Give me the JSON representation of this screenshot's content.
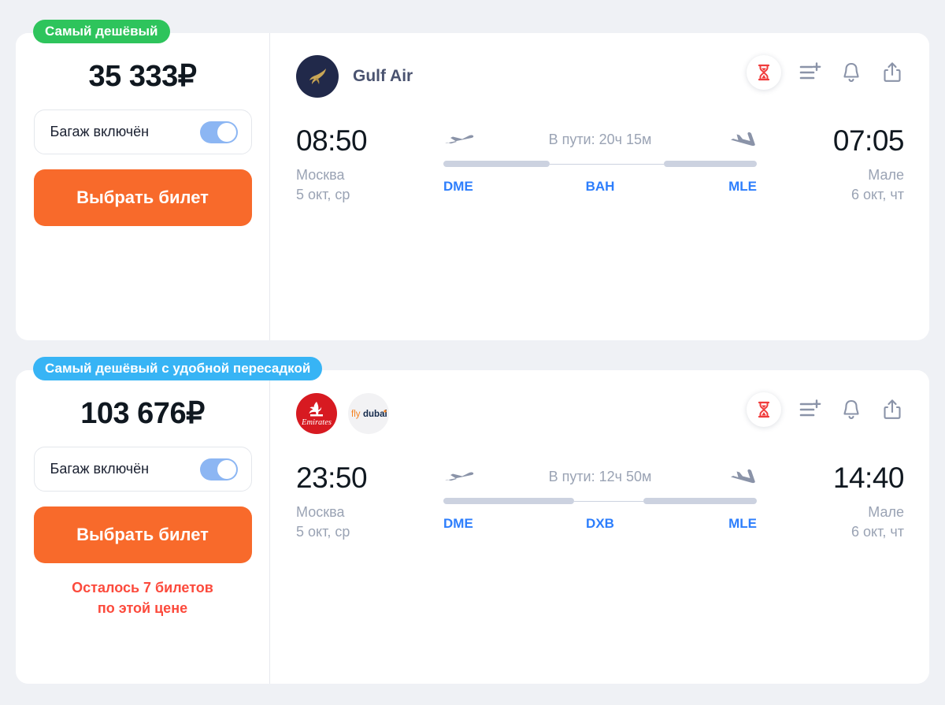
{
  "cards": [
    {
      "badge": {
        "text": "Самый дешёвый",
        "color": "#2ec45c"
      },
      "price": "35 333₽",
      "baggage_label": "Багаж включён",
      "baggage_on": true,
      "select_label": "Выбрать билет",
      "seats_left": "",
      "airlines": [
        {
          "name": "Gulf Air",
          "logo": "gulf-air-logo"
        }
      ],
      "airline_name": "Gulf Air",
      "departure": {
        "time": "08:50",
        "city": "Москва",
        "date": "5 окт, ср",
        "code": "DME"
      },
      "arrival": {
        "time": "07:05",
        "city": "Мале",
        "date": "6 окт, чт",
        "code": "MLE"
      },
      "duration": "В пути: 20ч 15м",
      "stop_code": "BAH"
    },
    {
      "badge": {
        "text": "Самый дешёвый с удобной пересадкой",
        "color": "#37b4f5"
      },
      "price": "103 676₽",
      "baggage_label": "Багаж включён",
      "baggage_on": true,
      "select_label": "Выбрать билет",
      "seats_left": "Осталось 7 билетов\nпо этой цене",
      "seats_left_line1": "Осталось 7 билетов",
      "seats_left_line2": "по этой цене",
      "airlines": [
        {
          "name": "Emirates",
          "logo": "emirates-logo"
        },
        {
          "name": "flydubai",
          "logo": "flydubai-logo"
        }
      ],
      "airline_name": "",
      "departure": {
        "time": "23:50",
        "city": "Москва",
        "date": "5 окт, ср",
        "code": "DME"
      },
      "arrival": {
        "time": "14:40",
        "city": "Мале",
        "date": "6 окт, чт",
        "code": "MLE"
      },
      "duration": "В пути: 12ч 50м",
      "stop_code": "DXB"
    }
  ],
  "icons": {
    "hourglass": "hourglass-icon",
    "compare": "add-to-compare-icon",
    "bell": "price-alert-bell-icon",
    "share": "share-icon",
    "takeoff": "airplane-takeoff-icon",
    "landing": "airplane-landing-icon"
  },
  "colors": {
    "background": "#eff1f5",
    "card": "#ffffff",
    "accent_orange": "#f86a2b",
    "badge_green": "#2ec45c",
    "badge_blue": "#37b4f5",
    "code_blue": "#2d7efc",
    "alert_red": "#fc4a3c",
    "toggle_on": "#8cb6f3",
    "muted_text": "#9aa3b4"
  }
}
